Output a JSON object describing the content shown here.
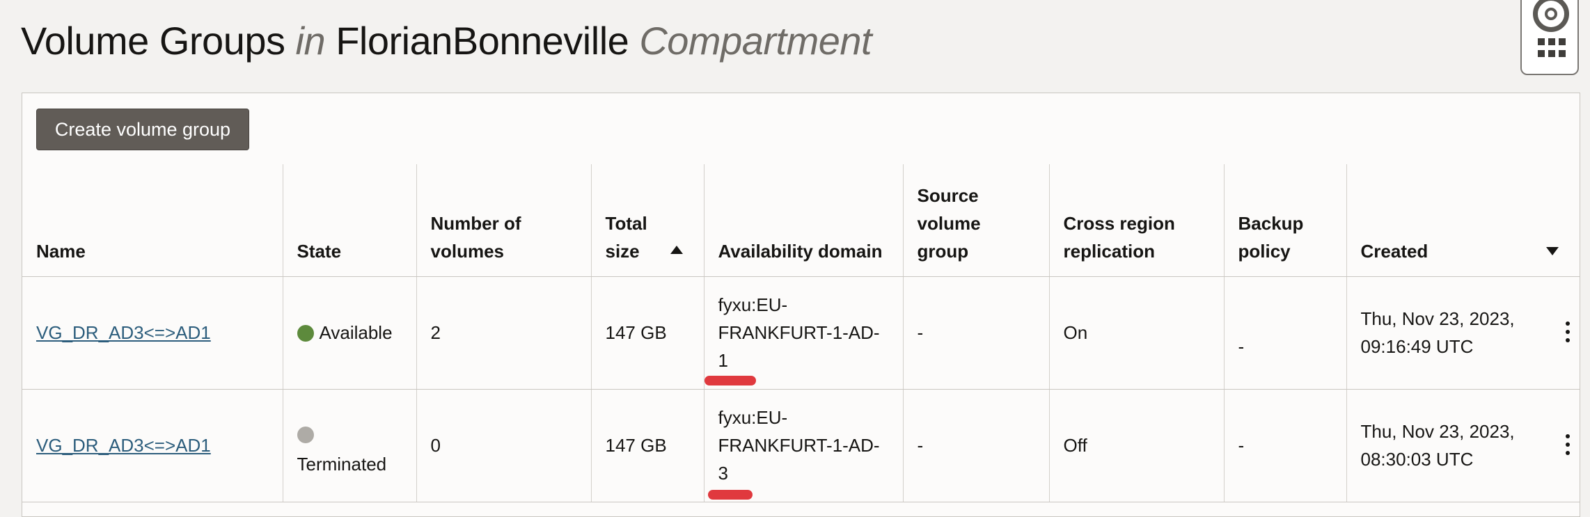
{
  "header": {
    "title_part1": "Volume Groups",
    "title_in": "in",
    "compartment_name": "FlorianBonneville",
    "compartment_label": "Compartment"
  },
  "help_widget": {
    "icons": [
      "lifebuoy-icon",
      "apps-grid-icon"
    ]
  },
  "toolbar": {
    "create_label": "Create volume group"
  },
  "table": {
    "columns": [
      "Name",
      "State",
      "Number of volumes",
      "Total size",
      "Availability domain",
      "Source volume group",
      "Cross region replication",
      "Backup policy",
      "Created"
    ],
    "sort": {
      "total_size": "ascending",
      "created": "descending"
    },
    "rows": [
      {
        "name": "VG_DR_AD3<=>AD1",
        "state": "Available",
        "state_color": "#5d8a3c",
        "volumes": "2",
        "size": "147 GB",
        "ad_line1": "fyxu:EU-",
        "ad_line2": "FRANKFURT-1-AD-",
        "ad_line3": "1",
        "source": "-",
        "replication": "On",
        "backup": "-",
        "created_line1": "Thu, Nov 23, 2023,",
        "created_line2": "09:16:49 UTC"
      },
      {
        "name": "VG_DR_AD3<=>AD1",
        "state": "Terminated",
        "state_color": "#aeaba6",
        "volumes": "0",
        "size": "147 GB",
        "ad_line1": "fyxu:EU-",
        "ad_line2": "FRANKFURT-1-AD-",
        "ad_line3": "3",
        "source": "-",
        "replication": "Off",
        "backup": "-",
        "created_line1": "Thu, Nov 23, 2023,",
        "created_line2": "08:30:03 UTC"
      }
    ]
  },
  "annotation_color": "#e0393e"
}
